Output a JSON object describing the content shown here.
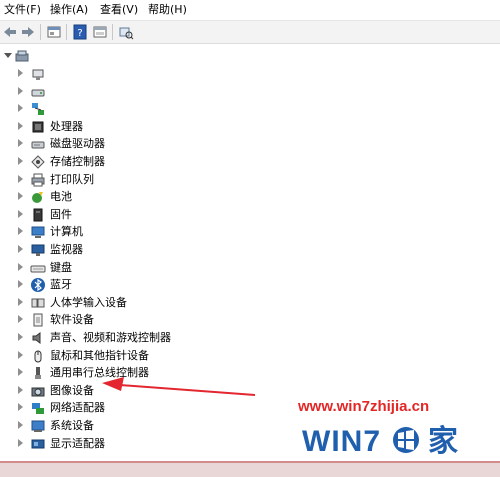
{
  "menubar": {
    "file": "文件(F)",
    "action": "操作(A)",
    "view": "查看(V)",
    "help": "帮助(H)"
  },
  "toolbar": {
    "buttons": [
      "back-arrow-icon",
      "forward-arrow-icon",
      "properties-icon",
      "help-icon",
      "scope-icon",
      "scan-hardware-icon"
    ]
  },
  "tree": {
    "root_label": "",
    "items": [
      {
        "label": "",
        "icon": "audio-io-icon"
      },
      {
        "label": "",
        "icon": "storage-icon"
      },
      {
        "label": "",
        "icon": "network-icon"
      },
      {
        "label": "处理器",
        "icon": "processor-icon"
      },
      {
        "label": "磁盘驱动器",
        "icon": "disk-drive-icon"
      },
      {
        "label": "存储控制器",
        "icon": "storage-controller-icon"
      },
      {
        "label": "打印队列",
        "icon": "printer-icon"
      },
      {
        "label": "电池",
        "icon": "battery-icon"
      },
      {
        "label": "固件",
        "icon": "firmware-icon"
      },
      {
        "label": "计算机",
        "icon": "computer-icon"
      },
      {
        "label": "监视器",
        "icon": "monitor-icon"
      },
      {
        "label": "键盘",
        "icon": "keyboard-icon"
      },
      {
        "label": "蓝牙",
        "icon": "bluetooth-icon"
      },
      {
        "label": "人体学输入设备",
        "icon": "hid-icon"
      },
      {
        "label": "软件设备",
        "icon": "software-device-icon"
      },
      {
        "label": "声音、视频和游戏控制器",
        "icon": "speaker-icon"
      },
      {
        "label": "鼠标和其他指针设备",
        "icon": "mouse-icon"
      },
      {
        "label": "通用串行总线控制器",
        "icon": "usb-icon"
      },
      {
        "label": "图像设备",
        "icon": "camera-icon"
      },
      {
        "label": "网络适配器",
        "icon": "network-adapter-icon"
      },
      {
        "label": "系统设备",
        "icon": "system-device-icon"
      },
      {
        "label": "显示适配器",
        "icon": "display-adapter-icon"
      }
    ]
  },
  "annotation": {
    "arrow_color": "#e3262f",
    "arrow_target": "图像设备"
  },
  "watermark": {
    "url": "www.win7zhijia.cn",
    "logo_text": "WIN7",
    "logo_char": "家",
    "color": "#1f5fae"
  }
}
